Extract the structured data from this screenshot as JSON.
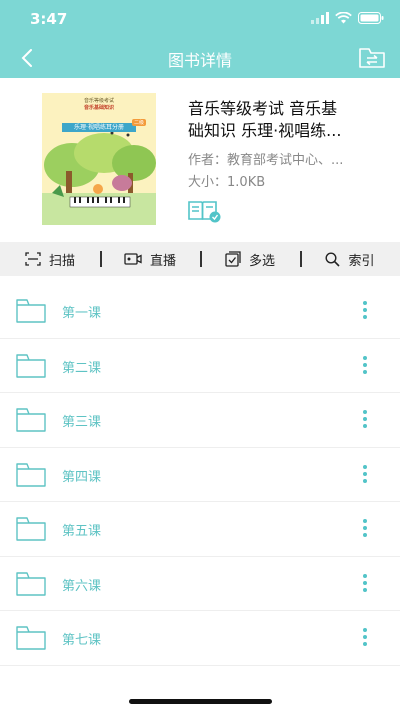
{
  "status_bar": {
    "time": "3:47"
  },
  "nav": {
    "title": "图书详情"
  },
  "book": {
    "title_line1": "音乐等级考试 音乐基",
    "title_line2": "础知识 乐理·视唱练...",
    "author_label": "作者：",
    "author": "教育部考试中心、...",
    "size_label": "大小：",
    "size": "1.0KB",
    "cover": {
      "top_text": "音乐等级考试",
      "series_text": "音乐基础知识",
      "subtitle": "乐理·视唱练耳分册",
      "tag": "二级"
    }
  },
  "toolbar": {
    "scan": "扫描",
    "live": "直播",
    "multi_select": "多选",
    "index": "索引"
  },
  "lessons": [
    "第一课",
    "第二课",
    "第三课",
    "第四课",
    "第五课",
    "第六课",
    "第七课"
  ],
  "colors": {
    "accent": "#7dd7d4",
    "folder": "#5ec3c4",
    "toolbar_bg": "#f0f0f0"
  }
}
